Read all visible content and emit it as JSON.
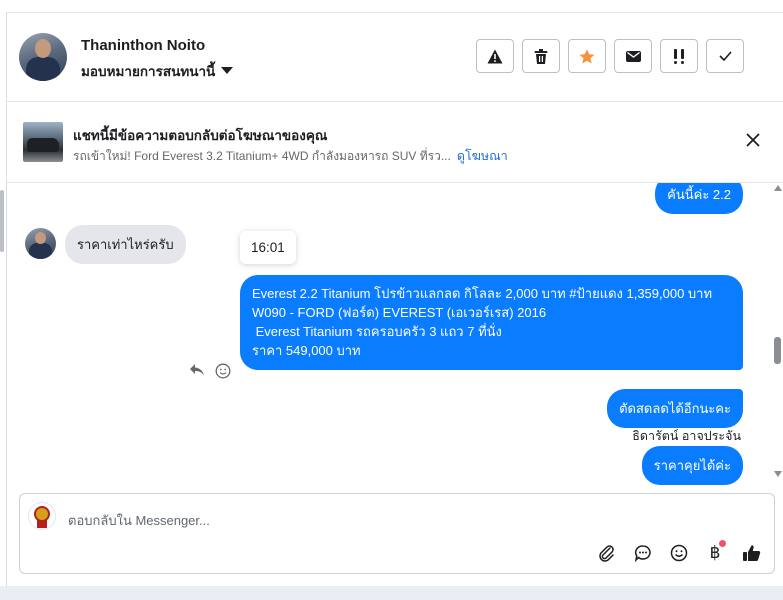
{
  "header": {
    "name": "Thaninthon Noito",
    "assign_label": "มอบหมายการสนทนานี้",
    "actions": [
      {
        "name": "spam-button",
        "icon": "warning-icon"
      },
      {
        "name": "delete-button",
        "icon": "trash-icon"
      },
      {
        "name": "star-button",
        "icon": "star-icon",
        "color": "#f7923b"
      },
      {
        "name": "mark-unread-button",
        "icon": "envelope-icon"
      },
      {
        "name": "follow-up-button",
        "icon": "double-exclamation-icon"
      },
      {
        "name": "mark-done-button",
        "icon": "checkmark-icon"
      }
    ]
  },
  "ad_notice": {
    "title": "แชทนี้มีข้อความตอบกลับต่อโฆษณาของคุณ",
    "description": "รถเข้าใหม่! Ford Everest 3.2 Titanium+ 4WD กำลังมองหารถ SUV ที่รว...",
    "link": "ดูโฆษณา"
  },
  "messages": {
    "out_1": "คันนี้ค่ะ 2.2",
    "in_1": "ราคาเท่าไหร่ครับ",
    "timestamp": "16:01",
    "out_2_lines": [
      "Everest 2.2 Titanium โปรข้าวแลกลด กิโลละ 2,000 บาท #ป้ายแดง 1,359,000 บาท",
      "W090 - FORD (ฟอร์ด) EVEREST (เอเวอร์เรส) 2016",
      "",
      " Everest Titanium รถครอบครัว 3 แถว 7 ที่นั่ง",
      "ราคา 549,000 บาท"
    ],
    "out_3": "ตัดสดลดได้อีกนะคะ",
    "sender_name": "ธิดารัตน์ อาจประจัน",
    "out_4": "ราคาคุยได้ค่ะ"
  },
  "composer": {
    "placeholder": "ตอบกลับใน Messenger...",
    "baht_symbol": "฿"
  },
  "colors": {
    "accent": "#0a7cff",
    "link": "#216fdb",
    "notification_dot": "#f0526b"
  }
}
